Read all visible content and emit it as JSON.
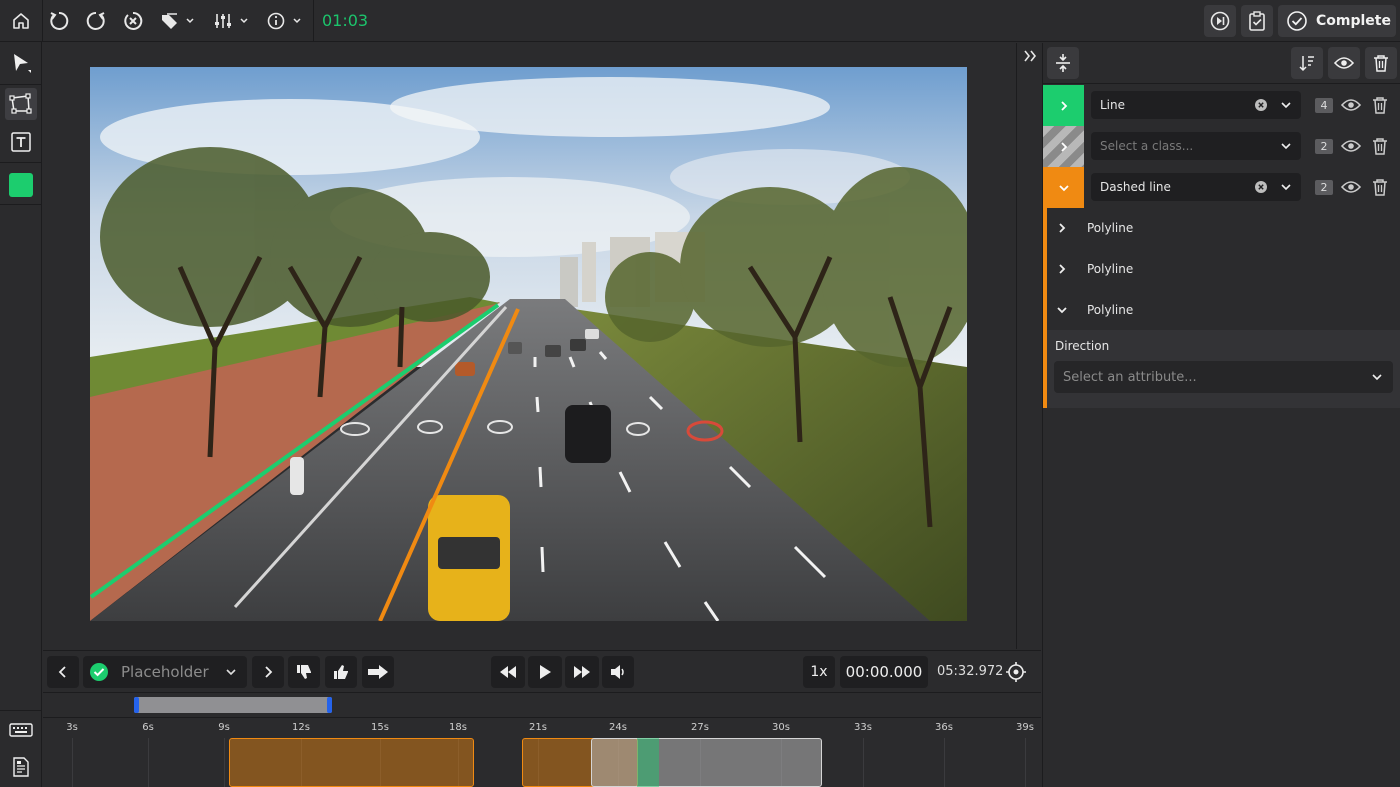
{
  "topbar": {
    "timer": "01:03",
    "complete_label": "Complete",
    "icons": [
      "home-icon",
      "undo-icon",
      "redo-icon",
      "clear-icon",
      "tags-icon",
      "sliders-icon",
      "info-icon",
      "skip-icon",
      "checklist-icon",
      "check-circle-icon"
    ]
  },
  "lefttools": {
    "active_color": "#1ccd6e",
    "icons": [
      "pointer-icon",
      "polyline-tool-icon",
      "text-tool-icon",
      "keyboard-icon",
      "document-icon"
    ]
  },
  "controls": {
    "placeholder": "Placeholder",
    "speed": "1x",
    "current_time": "00:00.000",
    "total_time": "05:32.972"
  },
  "timeline": {
    "ticks": [
      "3s",
      "6s",
      "9s",
      "12s",
      "15s",
      "18s",
      "21s",
      "24s",
      "27s",
      "30s",
      "33s",
      "36s",
      "39s"
    ]
  },
  "panel": {
    "classes": [
      {
        "label": "Line",
        "placeholder": "",
        "count": "4",
        "color": "#1ccd6e",
        "expanded": false
      },
      {
        "label": "",
        "placeholder": "Select a class...",
        "count": "2",
        "color": "#a9a9a9",
        "expanded": false
      },
      {
        "label": "Dashed line",
        "placeholder": "",
        "count": "2",
        "color": "#f08a12",
        "expanded": true
      }
    ],
    "instances": [
      "Polyline",
      "Polyline",
      "Polyline"
    ],
    "attribute": {
      "label": "Direction",
      "placeholder": "Select an attribute..."
    }
  }
}
